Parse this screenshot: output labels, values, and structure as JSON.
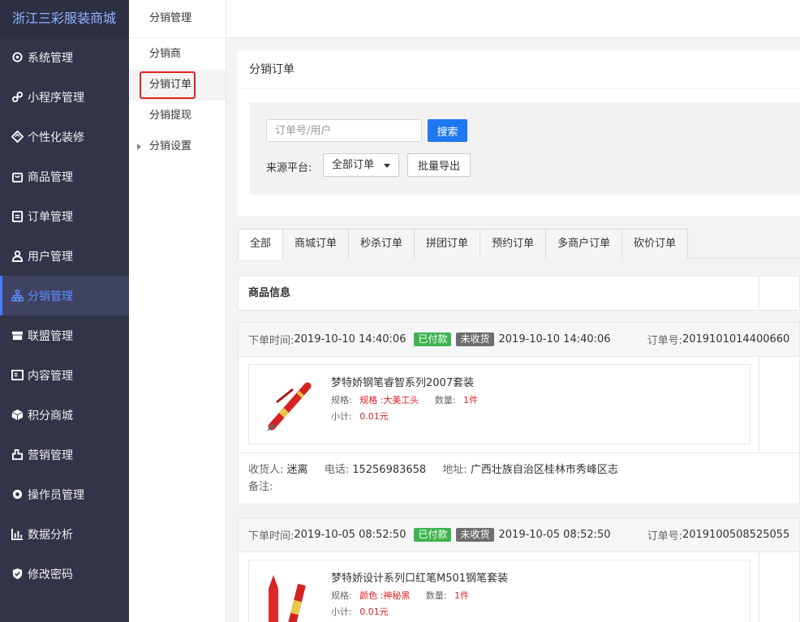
{
  "sidebar": {
    "brand": "浙江三彩服装商城",
    "items": [
      {
        "label": "系统管理",
        "icon": "gear-icon"
      },
      {
        "label": "小程序管理",
        "icon": "miniprogram-icon"
      },
      {
        "label": "个性化装修",
        "icon": "decoration-icon"
      },
      {
        "label": "商品管理",
        "icon": "bag-icon"
      },
      {
        "label": "订单管理",
        "icon": "clipboard-icon"
      },
      {
        "label": "用户管理",
        "icon": "user-icon"
      },
      {
        "label": "分销管理",
        "icon": "hierarchy-icon"
      },
      {
        "label": "联盟管理",
        "icon": "store-icon"
      },
      {
        "label": "内容管理",
        "icon": "content-icon"
      },
      {
        "label": "积分商城",
        "icon": "cube-icon"
      },
      {
        "label": "营销管理",
        "icon": "marketing-icon"
      },
      {
        "label": "操作员管理",
        "icon": "operator-gear-icon"
      },
      {
        "label": "数据分析",
        "icon": "bar-chart-icon"
      },
      {
        "label": "修改密码",
        "icon": "shield-check-icon"
      }
    ]
  },
  "subnav": {
    "title": "分销管理",
    "items": [
      {
        "label": "分销商"
      },
      {
        "label": "分销订单"
      },
      {
        "label": "分销提现"
      },
      {
        "label": "分销设置"
      }
    ]
  },
  "search_card": {
    "title": "分销订单",
    "search_placeholder": "订单号/用户",
    "search_button": "搜索",
    "source_label": "来源平台:",
    "source_select": "全部订单",
    "export_button": "批量导出"
  },
  "tabs": [
    "全部",
    "商城订单",
    "秒杀订单",
    "拼团订单",
    "预约订单",
    "多商户订单",
    "砍价订单"
  ],
  "table": {
    "goods_header": "商品信息"
  },
  "labels": {
    "order_time": "下单时间:",
    "order_no": "订单号:",
    "spec": "规格:",
    "qty": "数量:",
    "subtotal": "小计:",
    "receiver": "收货人:",
    "phone": "电话:",
    "address": "地址:",
    "remark": "备注:"
  },
  "orders": [
    {
      "order_time": "2019-10-10 14:40:06",
      "pay_status": "已付款",
      "ship_status": "未收货",
      "pay_time": "2019-10-10 14:40:06",
      "order_no": "2019101014400660",
      "goods_name": "梦特娇钢笔睿智系列2007套装",
      "spec": "规格 :大美工头",
      "qty": "1件",
      "subtotal": "0.01元",
      "receiver": "迷离",
      "phone": "15256983658",
      "address": "广西壮族自治区桂林市秀峰区志",
      "remark": ""
    },
    {
      "order_time": "2019-10-05 08:52:50",
      "pay_status": "已付款",
      "ship_status": "未收货",
      "pay_time": "2019-10-05 08:52:50",
      "order_no": "2019100508525055",
      "goods_name": "梦特娇设计系列口红笔M501钢笔套装",
      "spec": "颜色 :神秘黑",
      "qty": "1件",
      "subtotal": "0.01元"
    }
  ],
  "colors": {
    "sidebar_bg": "#32344a",
    "accent": "#1f77f2",
    "paid_badge": "#3fb34f",
    "unshipped_badge": "#6e6e6e",
    "price_red": "#e02020"
  }
}
